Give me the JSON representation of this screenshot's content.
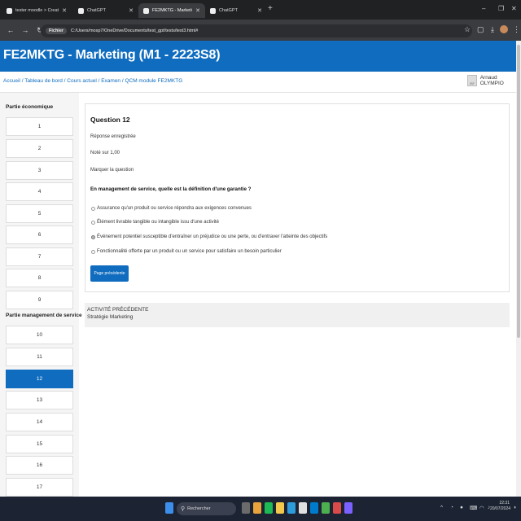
{
  "browser": {
    "tabs": [
      {
        "label": "tester moodle > Create New Mo...",
        "active": false
      },
      {
        "label": "ChatGPT",
        "active": false
      },
      {
        "label": "FE2MKTG - Marketing (M1 - 2...",
        "active": true
      },
      {
        "label": "ChatGPT",
        "active": false
      }
    ],
    "address": {
      "prefix": "Fichier",
      "url": "C:/Users/mosp7/OneDrive/Documents/test_gpt/tests/test3.html#"
    }
  },
  "site": {
    "title": "FE2MKTG - Marketing (M1 - 2223S8)"
  },
  "breadcrumb": "Accueil / Tableau de bord / Cours actuel / Examen / QCM module FE2MKTG",
  "user": {
    "name": "Arnaud OLYMPIO",
    "avatar_text": "ISF"
  },
  "nav": {
    "section1_title": "Partie économique",
    "section1_items": [
      "1",
      "2",
      "3",
      "4",
      "5",
      "6",
      "7",
      "8",
      "9"
    ],
    "section2_title": "Partie management de service",
    "section2_items": [
      "10",
      "11",
      "12",
      "13",
      "14",
      "15",
      "16",
      "17"
    ],
    "active_item": "12"
  },
  "question": {
    "title": "Question 12",
    "status": "Réponse enregistrée",
    "grade": "Noté sur 1,00",
    "flag": "Marquer la question",
    "text": "En management de service, quelle est la définition d'une garantie ?",
    "options": [
      {
        "label": "Assurance qu'un produit ou service répondra aux exigences convenues",
        "selected": false
      },
      {
        "label": "Élément livrable tangible ou intangible issu d'une activité",
        "selected": false
      },
      {
        "label": "Événement potentiel susceptible d'entraîner un préjudice ou une perte, ou d'entraver l'atteinte des objectifs",
        "selected": true
      },
      {
        "label": "Fonctionnalité offerte par un produit ou un service pour satisfaire un besoin particulier",
        "selected": false
      }
    ],
    "prev_button": "Page précédente"
  },
  "activity": {
    "label": "ACTIVITÉ PRÉCÉDENTE",
    "name": "Stratégie Marketing"
  },
  "taskbar": {
    "search_placeholder": "Rechercher",
    "time": "22:31",
    "date": "20/07/2024"
  },
  "colors": {
    "brand": "#0f6cbf",
    "taskbar": "#1c2433",
    "tabbar": "#1f2123"
  }
}
